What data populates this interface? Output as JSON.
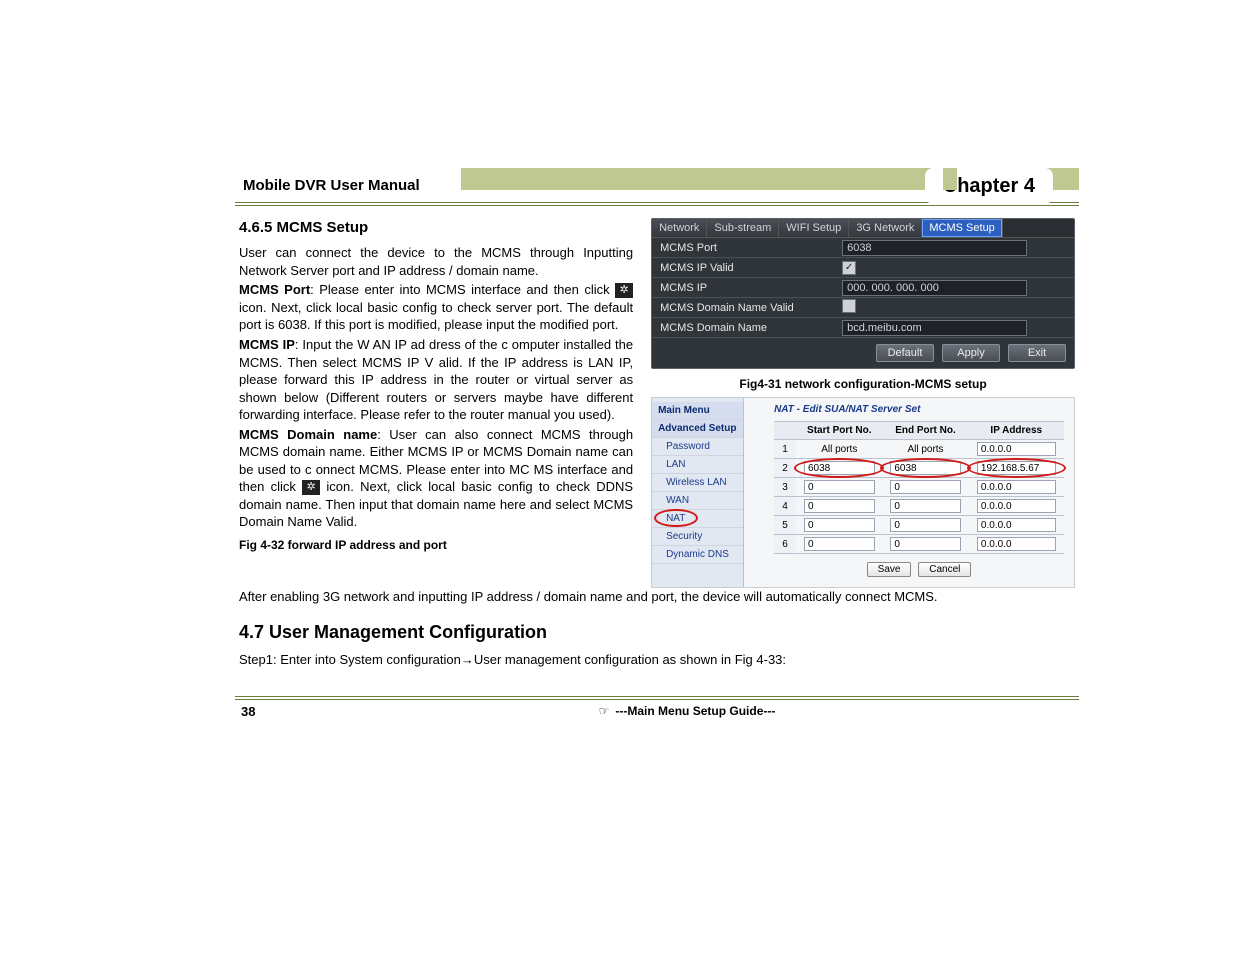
{
  "header": {
    "title": "Mobile DVR User Manual",
    "chapter": "Chapter 4"
  },
  "sections": {
    "s465_title": "4.6.5  MCMS Setup",
    "s47_title": "4.7  User Management Configuration"
  },
  "body": {
    "p1": "User can connect the device to the MCMS through Inputting Network Server port and IP address / domain name.",
    "p2_b": "MCMS Port",
    "p2_a": ": Please enter into MCMS interface and then click ",
    "p2_c": " icon. Next, click local basic config to check server port. The default port is 6038. If this port is modified, please input the modified port.",
    "p3_b": "MCMS IP",
    "p3_a": ": Input the W AN IP ad dress of the c omputer installed the MCMS. Then select MCMS IP V alid. If the IP address is LAN IP, please forward this IP address in the router or virtual server as shown below (Different routers or servers maybe have different forwarding interface. Please refer to the router manual you used).",
    "p4_b": "MCMS Domain name",
    "p4_a": ": User can also connect MCMS through MCMS domain name. Either MCMS IP or MCMS Domain name can be used to c onnect MCMS. Please enter into MC MS interface and then click ",
    "p4_c": " icon. Next, click local basic config to check DDNS domain name. Then input that domain name here and select MCMS Domain Name Valid.",
    "fig432": "Fig 4-32   forward IP address and port",
    "after": "After enabling 3G network and inputting IP address / domain name and port, the device will automatically connect MCMS.",
    "step1": "Step1: Enter into System configuration→User management configuration as shown in Fig 4-33:"
  },
  "dvr": {
    "tabs": [
      "Network",
      "Sub-stream",
      "WIFI Setup",
      "3G Network",
      "MCMS Setup"
    ],
    "active_tab_index": 4,
    "rows": {
      "port_label": "MCMS Port",
      "port_value": "6038",
      "ipvalid_label": "MCMS IP Valid",
      "ipvalid_checked": true,
      "ip_label": "MCMS IP",
      "ip_value": "000. 000. 000. 000",
      "dnvalid_label": "MCMS Domain Name Valid",
      "dnvalid_checked": false,
      "dn_label": "MCMS Domain Name",
      "dn_value": "bcd.meibu.com"
    },
    "buttons": {
      "default": "Default",
      "apply": "Apply",
      "exit": "Exit"
    },
    "caption": "Fig4-31 network configuration-MCMS setup"
  },
  "router": {
    "title": "NAT - Edit SUA/NAT Server Set",
    "sidebar": {
      "main": "Main Menu",
      "adv": "Advanced Setup",
      "items": [
        "Password",
        "LAN",
        "Wireless LAN",
        "WAN",
        "NAT",
        "Security",
        "Dynamic DNS"
      ]
    },
    "headers": {
      "idx": "",
      "start": "Start Port No.",
      "end": "End Port No.",
      "ip": "IP Address"
    },
    "rows": [
      {
        "idx": "1",
        "start": "All ports",
        "end": "All ports",
        "ip": "0.0.0.0",
        "plain": true
      },
      {
        "idx": "2",
        "start": "6038",
        "end": "6038",
        "ip": "192.168.5.67",
        "circled": true
      },
      {
        "idx": "3",
        "start": "0",
        "end": "0",
        "ip": "0.0.0.0"
      },
      {
        "idx": "4",
        "start": "0",
        "end": "0",
        "ip": "0.0.0.0"
      },
      {
        "idx": "5",
        "start": "0",
        "end": "0",
        "ip": "0.0.0.0"
      },
      {
        "idx": "6",
        "start": "0",
        "end": "0",
        "ip": "0.0.0.0"
      }
    ],
    "buttons": {
      "save": "Save",
      "cancel": "Cancel"
    }
  },
  "footer": {
    "page": "38",
    "text": "---Main Menu Setup Guide---",
    "hand": "☞"
  }
}
